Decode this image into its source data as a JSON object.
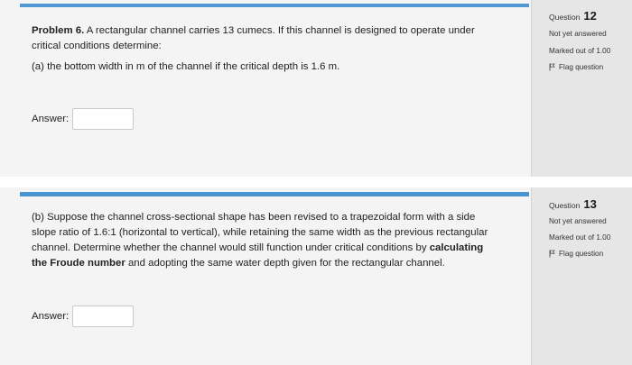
{
  "questions": [
    {
      "number_label": "Question",
      "number": "12",
      "status": "Not yet answered",
      "marks": "Marked out of 1.00",
      "flag_label": "Flag question",
      "problem_label": "Problem 6.",
      "intro": "A rectangular channel carries 13 cumecs. If this channel is designed to operate under critical conditions determine:",
      "part": "(a) the bottom width in m of the channel if the critical depth is 1.6 m.",
      "answer_label": "Answer:",
      "answer_value": ""
    },
    {
      "number_label": "Question",
      "number": "13",
      "status": "Not yet answered",
      "marks": "Marked out of 1.00",
      "flag_label": "Flag question",
      "part_before": "(b) Suppose the channel cross-sectional shape has been revised to a trapezoidal form with a side slope ratio of 1.6:1 (horizontal to vertical), while retaining the same width as the previous rectangular channel. Determine whether the channel would still function under critical conditions by",
      "part_bold": "calculating the Froude number",
      "part_after": "and adopting the same water depth given for the rectangular channel.",
      "answer_label": "Answer:",
      "answer_value": ""
    }
  ],
  "colors": {
    "accent": "#4a94d0",
    "content_bg": "#f4f4f4",
    "info_bg": "#e6e6e6"
  },
  "icons": {
    "flag": "flag-icon"
  }
}
